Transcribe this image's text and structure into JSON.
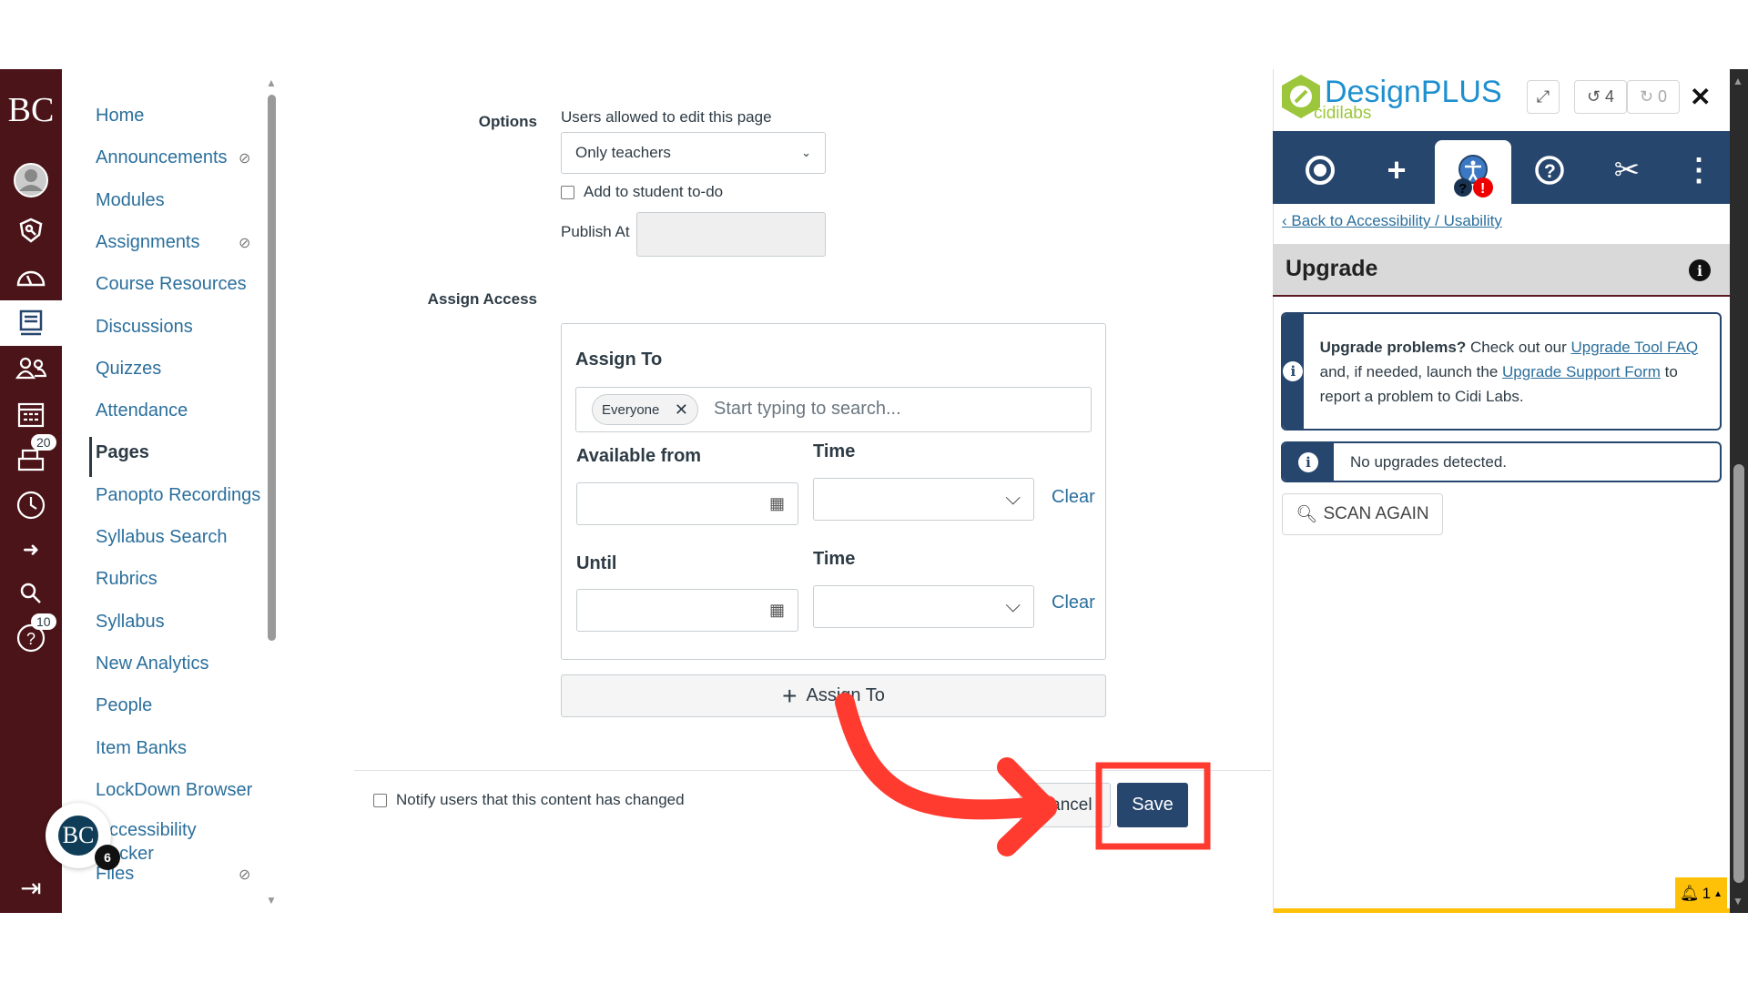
{
  "global_nav": {
    "logo": "BC",
    "badges": {
      "inbox": "20",
      "help": "10"
    },
    "bg_color": "#4b1418"
  },
  "course_nav": {
    "items": [
      {
        "label": "Home",
        "hidden": false
      },
      {
        "label": "Announcements",
        "hidden": true
      },
      {
        "label": "Modules",
        "hidden": false
      },
      {
        "label": "Assignments",
        "hidden": true
      },
      {
        "label": "Course Resources",
        "hidden": false
      },
      {
        "label": "Discussions",
        "hidden": false
      },
      {
        "label": "Quizzes",
        "hidden": false
      },
      {
        "label": "Attendance",
        "hidden": false
      },
      {
        "label": "Pages",
        "hidden": false,
        "current": true
      },
      {
        "label": "Panopto Recordings",
        "hidden": false
      },
      {
        "label": "Syllabus Search",
        "hidden": false
      },
      {
        "label": "Rubrics",
        "hidden": false
      },
      {
        "label": "Syllabus",
        "hidden": false
      },
      {
        "label": "New Analytics",
        "hidden": false
      },
      {
        "label": "People",
        "hidden": false
      },
      {
        "label": "Item Banks",
        "hidden": false
      },
      {
        "label": "LockDown Browser",
        "hidden": false
      },
      {
        "label": "ccessibility",
        "label2": "ecker",
        "hidden": false
      },
      {
        "label": "Files",
        "hidden": true
      }
    ],
    "floating_avatar": {
      "initials": "BC",
      "badge": "6"
    }
  },
  "form": {
    "options_label": "Options",
    "edit_label": "Users allowed to edit this page",
    "edit_value": "Only teachers",
    "todo_label": "Add to student to-do",
    "publish_label": "Publish At",
    "assign_access_label": "Assign Access",
    "assign_to_heading": "Assign To",
    "chip": "Everyone",
    "search_placeholder": "Start typing to search...",
    "available_from": "Available from",
    "time": "Time",
    "clear": "Clear",
    "until": "Until",
    "add_assign_to": "Assign To",
    "notify_label": "Notify users that this content has changed",
    "cancel": "Cancel",
    "save": "Save"
  },
  "designplus": {
    "brand": "DesignPLUS",
    "sub": "cidilabs",
    "undo_count": "4",
    "redo_count": "0",
    "back_link": "Back to Accessibility / Usability",
    "section_title": "Upgrade",
    "info_bold": "Upgrade problems?",
    "info_t1": " Check out our ",
    "info_link1": "Upgrade Tool FAQ",
    "info_t2": " and, if needed, launch the ",
    "info_link2": "Upgrade Support Form",
    "info_t3": " to report a problem to Cidi Labs.",
    "no_upgrades": "No upgrades detected.",
    "scan_again": "SCAN AGAIN",
    "notif_count": "1",
    "toolbar_color": "#27466e"
  },
  "annotation_color": "#ff3b30"
}
